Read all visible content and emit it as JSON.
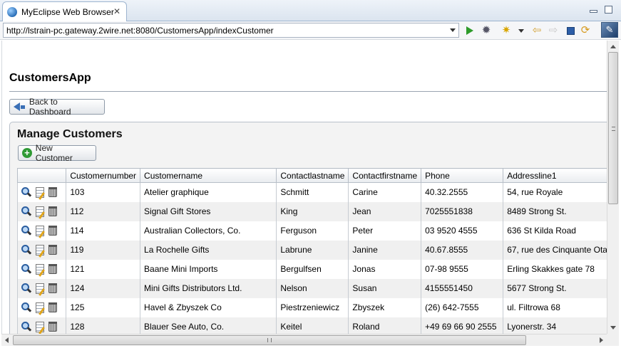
{
  "tab": {
    "title": "MyEclipse Web Browser",
    "icon": "globe-icon",
    "close_glyph": "✕"
  },
  "toolbar": {
    "url": "http://lstrain-pc.gateway.2wire.net:8080/CustomersApp/indexCustomer",
    "icons": [
      "go-icon",
      "gear-icon",
      "star-icon",
      "back-icon",
      "forward-icon",
      "stop-icon",
      "refresh-icon"
    ]
  },
  "page": {
    "app_title": "CustomersApp",
    "dashboard_button": "Back to Dashboard",
    "panel_title": "Manage Customers",
    "new_button": "New Customer"
  },
  "table": {
    "columns": [
      "",
      "Customernumber",
      "Customername",
      "Contactlastname",
      "Contactfirstname",
      "Phone",
      "Addressline1"
    ],
    "rows": [
      [
        "103",
        "Atelier graphique",
        "Schmitt",
        "Carine",
        "40.32.2555",
        "54, rue Royale"
      ],
      [
        "112",
        "Signal Gift Stores",
        "King",
        "Jean",
        "7025551838",
        "8489 Strong St."
      ],
      [
        "114",
        "Australian Collectors, Co.",
        "Ferguson",
        "Peter",
        "03 9520 4555",
        "636 St Kilda Road"
      ],
      [
        "119",
        "La Rochelle Gifts",
        "Labrune",
        "Janine",
        "40.67.8555",
        "67, rue des Cinquante Ota"
      ],
      [
        "121",
        "Baane Mini Imports",
        "Bergulfsen",
        "Jonas",
        "07-98 9555",
        "Erling Skakkes gate 78"
      ],
      [
        "124",
        "Mini Gifts Distributors Ltd.",
        "Nelson",
        "Susan",
        "4155551450",
        "5677 Strong St."
      ],
      [
        "125",
        "Havel & Zbyszek Co",
        "Piestrzeniewicz",
        "Zbyszek",
        "(26) 642-7555",
        "ul. Filtrowa 68"
      ],
      [
        "128",
        "Blauer See Auto, Co.",
        "Keitel",
        "Roland",
        "+49 69 66 90 2555",
        "Lyonerstr. 34"
      ]
    ]
  },
  "colors": {
    "accent": "#3a6fb6",
    "add": "#2f9a35",
    "alt_row": "#f0f0f0"
  }
}
